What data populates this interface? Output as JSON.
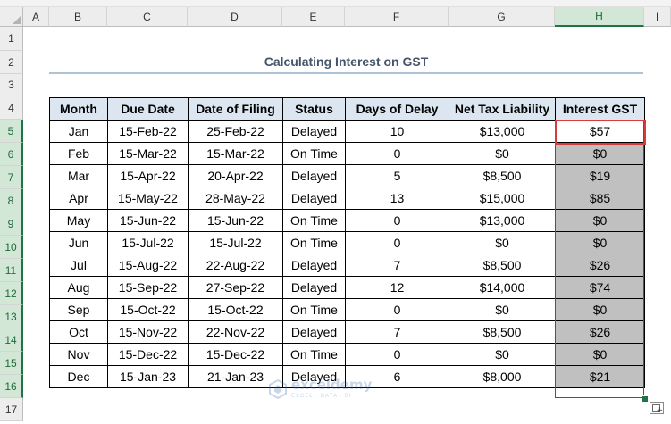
{
  "column_headers": [
    "A",
    "B",
    "C",
    "D",
    "E",
    "F",
    "G",
    "H",
    "I"
  ],
  "selected_column": "H",
  "row_numbers": [
    "1",
    "2",
    "3",
    "4",
    "5",
    "6",
    "7",
    "8",
    "9",
    "10",
    "11",
    "12",
    "13",
    "14",
    "15",
    "16",
    "17"
  ],
  "title": "Calculating Interest on GST",
  "table": {
    "headers": [
      "Month",
      "Due Date",
      "Date of Filing",
      "Status",
      "Days of Delay",
      "Net Tax Liability",
      "Interest GST"
    ],
    "rows": [
      [
        "Jan",
        "15-Feb-22",
        "25-Feb-22",
        "Delayed",
        "10",
        "$13,000",
        "$57"
      ],
      [
        "Feb",
        "15-Mar-22",
        "15-Mar-22",
        "On Time",
        "0",
        "$0",
        "$0"
      ],
      [
        "Mar",
        "15-Apr-22",
        "20-Apr-22",
        "Delayed",
        "5",
        "$8,500",
        "$19"
      ],
      [
        "Apr",
        "15-May-22",
        "28-May-22",
        "Delayed",
        "13",
        "$15,000",
        "$85"
      ],
      [
        "May",
        "15-Jun-22",
        "15-Jun-22",
        "On Time",
        "0",
        "$13,000",
        "$0"
      ],
      [
        "Jun",
        "15-Jul-22",
        "15-Jul-22",
        "On Time",
        "0",
        "$0",
        "$0"
      ],
      [
        "Jul",
        "15-Aug-22",
        "22-Aug-22",
        "Delayed",
        "7",
        "$8,500",
        "$26"
      ],
      [
        "Aug",
        "15-Sep-22",
        "27-Sep-22",
        "Delayed",
        "12",
        "$14,000",
        "$74"
      ],
      [
        "Sep",
        "15-Oct-22",
        "15-Oct-22",
        "On Time",
        "0",
        "$0",
        "$0"
      ],
      [
        "Oct",
        "15-Nov-22",
        "22-Nov-22",
        "Delayed",
        "7",
        "$8,500",
        "$26"
      ],
      [
        "Nov",
        "15-Dec-22",
        "15-Dec-22",
        "On Time",
        "0",
        "$0",
        "$0"
      ],
      [
        "Dec",
        "15-Jan-23",
        "21-Jan-23",
        "Delayed",
        "6",
        "$8,000",
        "$21"
      ]
    ]
  },
  "watermark": {
    "name": "exceldemy",
    "tagline": "EXCEL · DATA · BI"
  },
  "colors": {
    "selection_green": "#217346",
    "active_cell_border": "#d83b3b",
    "header_fill": "#dce6f1",
    "highlight_fill": "#c0c0c0"
  },
  "icons": {
    "fill_handle": "fill-handle-icon",
    "quick_analysis": "quick-analysis-icon"
  }
}
